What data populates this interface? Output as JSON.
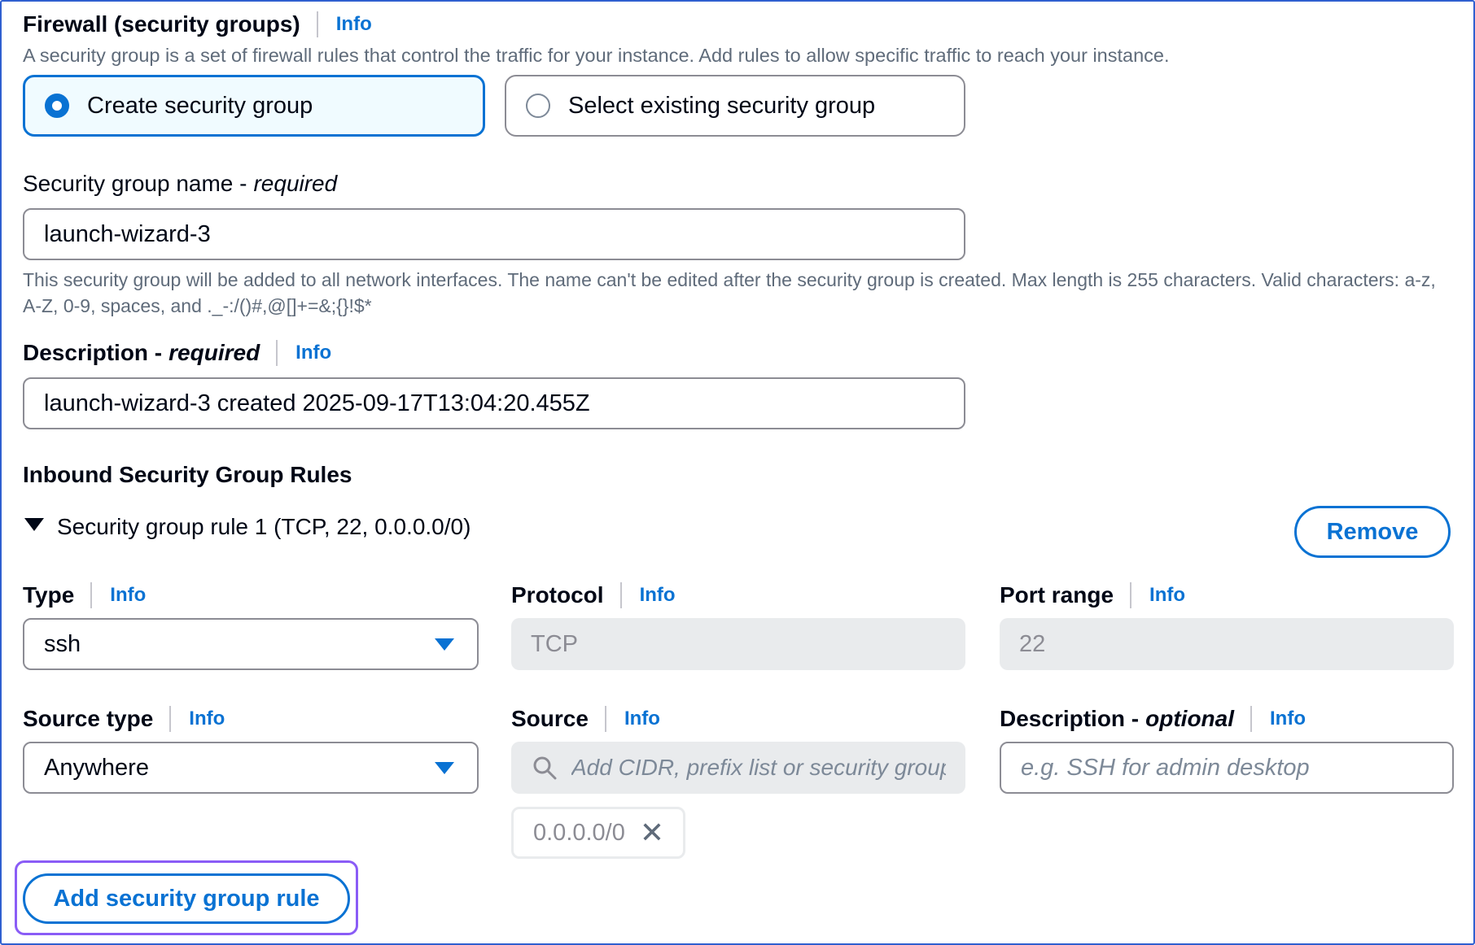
{
  "firewall": {
    "title": "Firewall (security groups)",
    "info": "Info",
    "description": "A security group is a set of firewall rules that control the traffic for your instance. Add rules to allow specific traffic to reach your instance.",
    "options": [
      {
        "label": "Create security group",
        "selected": true
      },
      {
        "label": "Select existing security group",
        "selected": false
      }
    ]
  },
  "sg_name": {
    "label": "Security group name -",
    "required": "required",
    "value": "launch-wizard-3",
    "help": "This security group will be added to all network interfaces. The name can't be edited after the security group is created. Max length is 255 characters. Valid characters: a-z, A-Z, 0-9, spaces, and ._-:/()#,@[]+=&;{}!$*"
  },
  "sg_description": {
    "label": "Description -",
    "required": "required",
    "info": "Info",
    "value": "launch-wizard-3 created 2025-09-17T13:04:20.455Z"
  },
  "inbound": {
    "title": "Inbound Security Group Rules",
    "rule_header": "Security group rule 1 (TCP, 22, 0.0.0.0/0)",
    "remove_label": "Remove",
    "type": {
      "label": "Type",
      "info": "Info",
      "value": "ssh"
    },
    "protocol": {
      "label": "Protocol",
      "info": "Info",
      "value": "TCP"
    },
    "port_range": {
      "label": "Port range",
      "info": "Info",
      "value": "22"
    },
    "source_type": {
      "label": "Source type",
      "info": "Info",
      "value": "Anywhere"
    },
    "source": {
      "label": "Source",
      "info": "Info",
      "placeholder": "Add CIDR, prefix list or security group",
      "token": "0.0.0.0/0"
    },
    "rule_description": {
      "label": "Description -",
      "optional": "optional",
      "info": "Info",
      "placeholder": "e.g. SSH for admin desktop"
    },
    "add_rule_label": "Add security group rule"
  },
  "colors": {
    "accent": "#0972d3",
    "focus": "#8a5cf6",
    "frame": "#2f5fd0"
  }
}
